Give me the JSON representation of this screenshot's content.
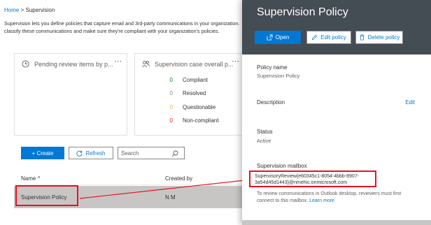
{
  "breadcrumb": {
    "home": "Home",
    "separator": ">",
    "current": "Supervision"
  },
  "intro": {
    "line1": "Supervision lets you define policies that capture email and 3rd-party communications in your organization. You can then",
    "line2": "classify these communications and make sure they're compliant with your organization's policies."
  },
  "cards": {
    "pending": {
      "title": "Pending review items by p...",
      "more": "⋯"
    },
    "overall": {
      "title": "Supervision case overall p...",
      "more": "⋯",
      "stats": [
        {
          "value": "0",
          "label": "Compliant",
          "color": "#107c10"
        },
        {
          "value": "0",
          "label": "Resolved",
          "color": "#8a8886"
        },
        {
          "value": "0",
          "label": "Questionable",
          "color": "#ffaa44"
        },
        {
          "value": "0",
          "label": "Non-compliant",
          "color": "#e81123"
        }
      ]
    }
  },
  "toolbar": {
    "create": "+ Create",
    "refresh": "Refresh",
    "search_placeholder": "Search"
  },
  "table": {
    "columns": {
      "name": "Name ^",
      "created_by": "Created by"
    },
    "rows": [
      {
        "name": "Supervision Policy",
        "created_by": "N M"
      }
    ]
  },
  "panel": {
    "title": "Supervision Policy",
    "buttons": {
      "open": "Open",
      "edit": "Edit policy",
      "delete": "Delete policy"
    },
    "fields": {
      "name_label": "Policy name",
      "name_value": "Supervision Policy",
      "description_label": "Description",
      "description_edit": "Edit",
      "status_label": "Status",
      "status_value": "Active",
      "mailbox_label": "Supervision mailbox",
      "mailbox_value": "SupervisoryReview{e60345c1-8054-4bbb-8907-3a54d45d1443}@nmehic.onmicrosoft.com",
      "mailbox_note": "To review communications in Outlook desktop, reviewers must first connect to this mailbox.",
      "learn_more": "Learn more"
    }
  },
  "colors": {
    "accent": "#0078d4",
    "panel_header": "#444c54",
    "annotation": "#e81123"
  }
}
